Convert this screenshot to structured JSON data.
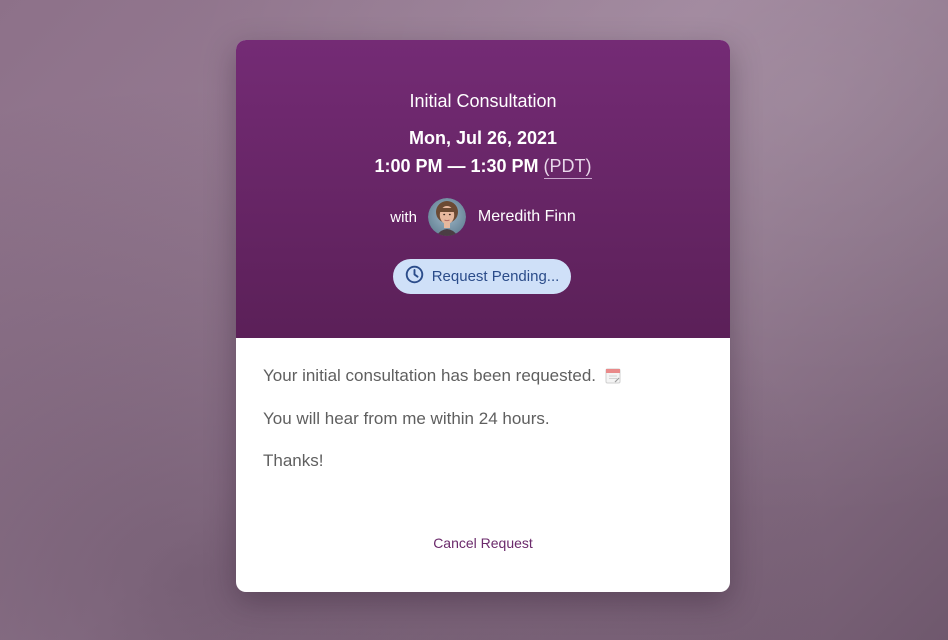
{
  "booking": {
    "title": "Initial Consultation",
    "date": "Mon, Jul 26, 2021",
    "time": "1:00 PM — 1:30 PM",
    "timezone": "(PDT)",
    "with_label": "with",
    "host_name": "Meredith Finn",
    "status": "Request Pending..."
  },
  "message": {
    "line1": "Your initial consultation has been requested.",
    "line2": "You will hear from me within 24 hours.",
    "line3": "Thanks!"
  },
  "actions": {
    "cancel_label": "Cancel Request"
  },
  "icons": {
    "status_icon": "clock-icon",
    "message_icon": "calendar-icon"
  },
  "colors": {
    "header_top": "#742b75",
    "header_bottom": "#5b2058",
    "status_bg": "#cfe0f8",
    "status_text": "#2b4c8a",
    "cancel_link": "#6b2a6b"
  }
}
